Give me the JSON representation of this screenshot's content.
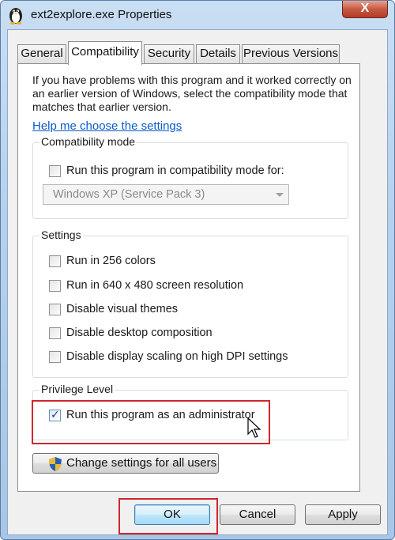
{
  "window": {
    "title": "ext2explore.exe Properties",
    "close_glyph": "X"
  },
  "tabs": [
    {
      "label": "General",
      "active": false
    },
    {
      "label": "Compatibility",
      "active": true
    },
    {
      "label": "Security",
      "active": false
    },
    {
      "label": "Details",
      "active": false
    },
    {
      "label": "Previous Versions",
      "active": false
    }
  ],
  "intro_text": "If you have problems with this program and it worked correctly on an earlier version of Windows, select the compatibility mode that matches that earlier version.",
  "help_link": "Help me choose the settings",
  "compat_mode": {
    "label": "Compatibility mode",
    "checkbox_label": "Run this program in compatibility mode for:",
    "checked": false,
    "select_value": "Windows XP (Service Pack 3)"
  },
  "settings": {
    "label": "Settings",
    "items": [
      {
        "label": "Run in 256 colors",
        "checked": false
      },
      {
        "label": "Run in 640 x 480 screen resolution",
        "checked": false
      },
      {
        "label": "Disable visual themes",
        "checked": false
      },
      {
        "label": "Disable desktop composition",
        "checked": false
      },
      {
        "label": "Disable display scaling on high DPI settings",
        "checked": false
      }
    ]
  },
  "privilege": {
    "label": "Privilege Level",
    "checkbox_label": "Run this program as an administrator",
    "checked": true,
    "checkmark": "✓"
  },
  "change_all_users": "Change settings for all users",
  "buttons": {
    "ok": "OK",
    "cancel": "Cancel",
    "apply": "Apply"
  },
  "colors": {
    "highlight": "#d0262e",
    "link": "#0a5cc9"
  }
}
